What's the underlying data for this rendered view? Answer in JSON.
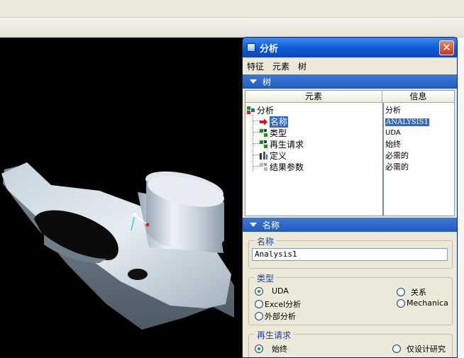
{
  "dialog": {
    "title": "分析",
    "close_glyph": "✕",
    "menu": [
      "特征",
      "元素",
      "树"
    ]
  },
  "tree_section": {
    "header": "树",
    "col_element": "元素",
    "col_info": "信息",
    "rows": [
      {
        "label": "分析",
        "info": "分析"
      },
      {
        "label": "名称",
        "info": "ANALYSIS1"
      },
      {
        "label": "类型",
        "info": "UDA"
      },
      {
        "label": "再生请求",
        "info": "始终"
      },
      {
        "label": "定义",
        "info": "必需的"
      },
      {
        "label": "结果参数",
        "info": "必需的"
      }
    ]
  },
  "name_section": {
    "header": "名称",
    "group_label": "名称",
    "value": "Analysis1"
  },
  "type_group": {
    "label": "类型",
    "options": [
      "UDA",
      "Excel分析",
      "外部分析",
      "关系",
      "Mechanica"
    ],
    "selected": "UDA"
  },
  "regen_group": {
    "label": "再生请求",
    "options": [
      "始终",
      "仅设计研究"
    ],
    "selected": "始终"
  },
  "icons": {
    "title": "window-icon",
    "close": "close-icon",
    "root": "analysis-tree-icon",
    "selected_item": "red-arrow-icon",
    "type": "feature-icon",
    "regen": "feature-icon",
    "definition": "parameter-icon",
    "result": "result-params-icon"
  },
  "colors": {
    "title_bar": "#0a5ad4",
    "section_header": "#2d66cc",
    "selection": "#316ac5",
    "viewport_bg": "#000000",
    "radio_on": "#21a121"
  }
}
